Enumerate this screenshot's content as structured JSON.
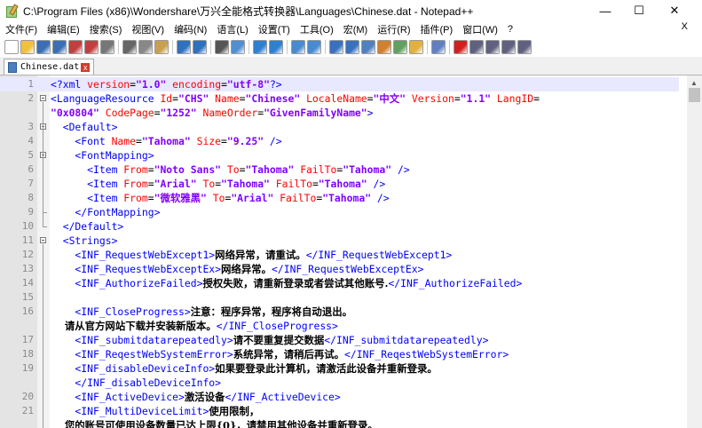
{
  "window": {
    "title": "C:\\Program Files (x86)\\Wondershare\\万兴全能格式转换器\\Languages\\Chinese.dat - Notepad++",
    "minimize": "—",
    "maximize": "☐",
    "close": "✕"
  },
  "menu": {
    "items": [
      "文件(F)",
      "编辑(E)",
      "搜索(S)",
      "视图(V)",
      "编码(N)",
      "语言(L)",
      "设置(T)",
      "工具(O)",
      "宏(M)",
      "运行(R)",
      "插件(P)",
      "窗口(W)",
      "?"
    ],
    "close": "X"
  },
  "toolbar": {
    "icons": [
      "new-icon",
      "open-icon",
      "save-icon",
      "save-all-icon",
      "close-icon",
      "close-all-icon",
      "print-icon",
      "cut-icon",
      "copy-icon",
      "paste-icon",
      "undo-icon",
      "redo-icon",
      "find-icon",
      "replace-icon",
      "zoom-in-icon",
      "zoom-out-icon",
      "sync-v-icon",
      "sync-h-icon",
      "wrap-icon",
      "show-all-icon",
      "indent-guide-icon",
      "lang-icon",
      "func-list-icon",
      "folder-icon",
      "monitor-icon",
      "record-icon",
      "stop-icon",
      "play-icon",
      "play-multi-icon",
      "save-macro-icon"
    ]
  },
  "tab": {
    "label": "Chinese.dat",
    "close": "x"
  },
  "editor": {
    "lines": [
      {
        "n": "1",
        "cur": true,
        "fold": "",
        "tokens": [
          [
            "tag",
            "<?xml "
          ],
          [
            "attr",
            "version"
          ],
          [
            "op",
            "="
          ],
          [
            "val",
            "\"1.0\""
          ],
          [
            "attr",
            " encoding"
          ],
          [
            "op",
            "="
          ],
          [
            "val",
            "\"utf-8\""
          ],
          [
            "tag",
            "?>"
          ]
        ]
      },
      {
        "n": "2",
        "fold": "box",
        "tokens": [
          [
            "tag",
            "<LanguageResource "
          ],
          [
            "attr",
            "Id"
          ],
          [
            "op",
            "="
          ],
          [
            "val",
            "\"CHS\""
          ],
          [
            "attr",
            " Name"
          ],
          [
            "op",
            "="
          ],
          [
            "val",
            "\"Chinese\""
          ],
          [
            "attr",
            " LocaleName"
          ],
          [
            "op",
            "="
          ],
          [
            "val",
            "\"中文\""
          ],
          [
            "attr",
            " Version"
          ],
          [
            "op",
            "="
          ],
          [
            "val",
            "\"1.1\""
          ],
          [
            "attr",
            " LangID"
          ],
          [
            "op",
            "="
          ]
        ]
      },
      {
        "n": "",
        "fold": "",
        "tokens": [
          [
            "val",
            "\"0x0804\""
          ],
          [
            "attr",
            " CodePage"
          ],
          [
            "op",
            "="
          ],
          [
            "val",
            "\"1252\""
          ],
          [
            "attr",
            " NameOrder"
          ],
          [
            "op",
            "="
          ],
          [
            "val",
            "\"GivenFamilyName\""
          ],
          [
            "tag",
            ">"
          ]
        ]
      },
      {
        "n": "3",
        "fold": "box",
        "tokens": [
          [
            "tag",
            "  <Default>"
          ]
        ]
      },
      {
        "n": "4",
        "fold": "",
        "tokens": [
          [
            "tag",
            "    <Font "
          ],
          [
            "attr",
            "Name"
          ],
          [
            "op",
            "="
          ],
          [
            "val",
            "\"Tahoma\""
          ],
          [
            "attr",
            " Size"
          ],
          [
            "op",
            "="
          ],
          [
            "val",
            "\"9.25\""
          ],
          [
            "tag",
            " />"
          ]
        ]
      },
      {
        "n": "5",
        "fold": "box",
        "tokens": [
          [
            "tag",
            "    <FontMapping>"
          ]
        ]
      },
      {
        "n": "6",
        "fold": "",
        "tokens": [
          [
            "tag",
            "      <Item "
          ],
          [
            "attr",
            "From"
          ],
          [
            "op",
            "="
          ],
          [
            "val",
            "\"Noto Sans\""
          ],
          [
            "attr",
            " To"
          ],
          [
            "op",
            "="
          ],
          [
            "val",
            "\"Tahoma\""
          ],
          [
            "attr",
            " FailTo"
          ],
          [
            "op",
            "="
          ],
          [
            "val",
            "\"Tahoma\""
          ],
          [
            "tag",
            " />"
          ]
        ]
      },
      {
        "n": "7",
        "fold": "",
        "tokens": [
          [
            "tag",
            "      <Item "
          ],
          [
            "attr",
            "From"
          ],
          [
            "op",
            "="
          ],
          [
            "val",
            "\"Arial\""
          ],
          [
            "attr",
            " To"
          ],
          [
            "op",
            "="
          ],
          [
            "val",
            "\"Tahoma\""
          ],
          [
            "attr",
            " FailTo"
          ],
          [
            "op",
            "="
          ],
          [
            "val",
            "\"Tahoma\""
          ],
          [
            "tag",
            " />"
          ]
        ]
      },
      {
        "n": "8",
        "fold": "",
        "tokens": [
          [
            "tag",
            "      <Item "
          ],
          [
            "attr",
            "From"
          ],
          [
            "op",
            "="
          ],
          [
            "val",
            "\"微软雅黑\""
          ],
          [
            "attr",
            " To"
          ],
          [
            "op",
            "="
          ],
          [
            "val",
            "\"Arial\""
          ],
          [
            "attr",
            " FailTo"
          ],
          [
            "op",
            "="
          ],
          [
            "val",
            "\"Tahoma\""
          ],
          [
            "tag",
            " />"
          ]
        ]
      },
      {
        "n": "9",
        "fold": "end",
        "tokens": [
          [
            "tag",
            "    </FontMapping>"
          ]
        ]
      },
      {
        "n": "10",
        "fold": "end",
        "tokens": [
          [
            "tag",
            "  </Default>"
          ]
        ]
      },
      {
        "n": "11",
        "fold": "box",
        "tokens": [
          [
            "tag",
            "  <Strings>"
          ]
        ]
      },
      {
        "n": "12",
        "fold": "",
        "tokens": [
          [
            "tag",
            "    <INF_RequestWebExcept1>"
          ],
          [
            "txt",
            "网络异常，请重试。"
          ],
          [
            "tag",
            "</INF_RequestWebExcept1>"
          ]
        ]
      },
      {
        "n": "13",
        "fold": "",
        "tokens": [
          [
            "tag",
            "    <INF_RequestWebExceptEx>"
          ],
          [
            "txt",
            "网络异常。"
          ],
          [
            "tag",
            "</INF_RequestWebExceptEx>"
          ]
        ]
      },
      {
        "n": "14",
        "fold": "",
        "tokens": [
          [
            "tag",
            "    <INF_AuthorizeFailed>"
          ],
          [
            "txt",
            "授权失败，请重新登录或者尝试其他账号."
          ],
          [
            "tag",
            "</INF_AuthorizeFailed>"
          ]
        ]
      },
      {
        "n": "15",
        "fold": "",
        "tokens": []
      },
      {
        "n": "16",
        "fold": "",
        "tokens": [
          [
            "tag",
            "    <INF_CloseProgress>"
          ],
          [
            "txt",
            "注意：程序异常，程序将自动退出。"
          ]
        ]
      },
      {
        "n": "",
        "fold": "",
        "tokens": [
          [
            "txt",
            "    请从官方网站下载并安装新版本。"
          ],
          [
            "tag",
            "</INF_CloseProgress>"
          ]
        ]
      },
      {
        "n": "17",
        "fold": "",
        "tokens": [
          [
            "tag",
            "    <INF_submitdatarepeatedly>"
          ],
          [
            "txt",
            "请不要重复提交数据"
          ],
          [
            "tag",
            "</INF_submitdatarepeatedly>"
          ]
        ]
      },
      {
        "n": "18",
        "fold": "",
        "tokens": [
          [
            "tag",
            "    <INF_ReqestWebSystemError>"
          ],
          [
            "txt",
            "系统异常，请稍后再试。"
          ],
          [
            "tag",
            "</INF_ReqestWebSystemError>"
          ]
        ]
      },
      {
        "n": "19",
        "fold": "",
        "tokens": [
          [
            "tag",
            "    <INF_disableDeviceInfo>"
          ],
          [
            "txt",
            "如果要登录此计算机，请激活此设备并重新登录。"
          ]
        ]
      },
      {
        "n": "",
        "fold": "",
        "tokens": [
          [
            "tag",
            "    </INF_disableDeviceInfo>"
          ]
        ]
      },
      {
        "n": "20",
        "fold": "",
        "tokens": [
          [
            "tag",
            "    <INF_ActiveDevice>"
          ],
          [
            "txt",
            "激活设备"
          ],
          [
            "tag",
            "</INF_ActiveDevice>"
          ]
        ]
      },
      {
        "n": "21",
        "fold": "",
        "tokens": [
          [
            "tag",
            "    <INF_MultiDeviceLimit>"
          ],
          [
            "txt",
            "使用限制，"
          ]
        ]
      },
      {
        "n": "",
        "fold": "",
        "tokens": [
          [
            "txt",
            "    您的账号可使用设备数量已达上限{0}，请禁用其他设备并重新登录。"
          ]
        ]
      }
    ]
  }
}
